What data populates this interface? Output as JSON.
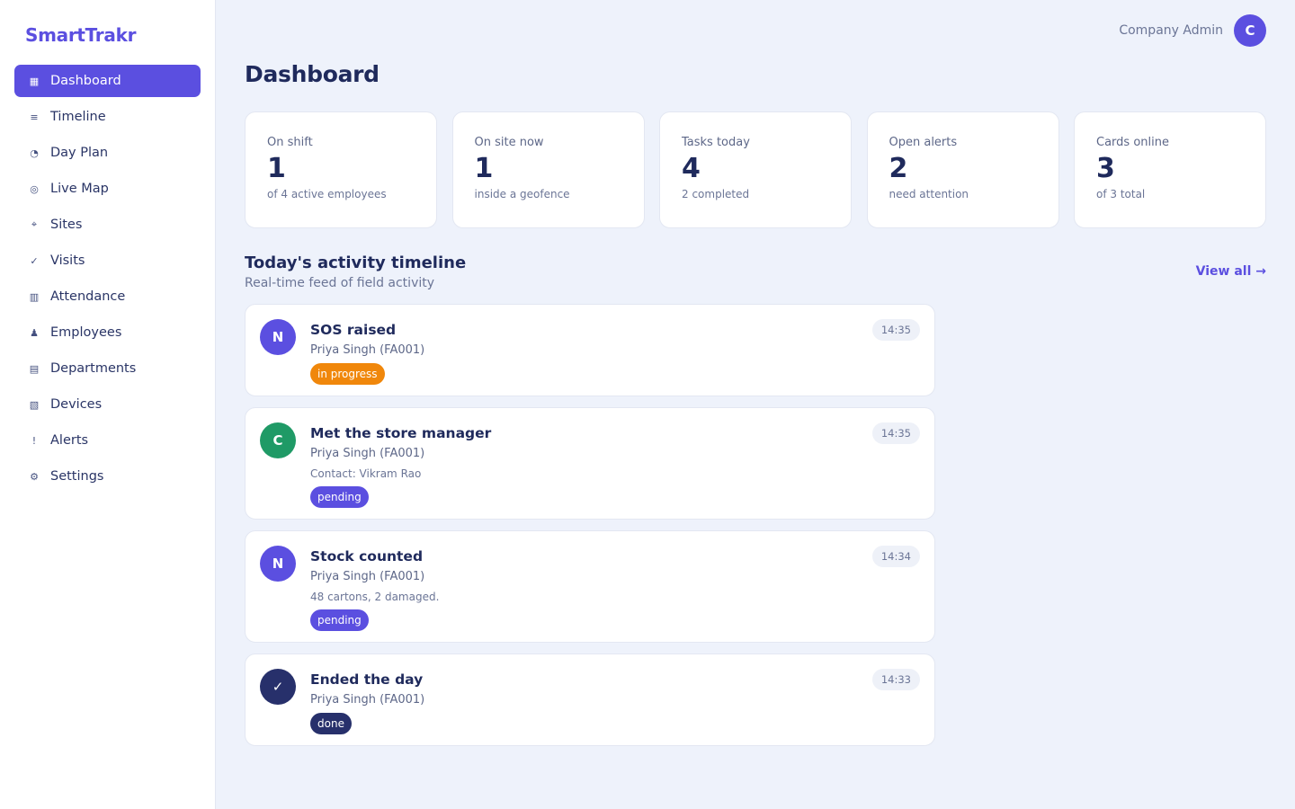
{
  "brand": "SmartTrakr",
  "sidebar": {
    "items": [
      {
        "label": "Dashboard",
        "icon": "grid-icon",
        "glyph": "▦",
        "active": true
      },
      {
        "label": "Timeline",
        "icon": "list-icon",
        "glyph": "≡",
        "active": false
      },
      {
        "label": "Day Plan",
        "icon": "pie-icon",
        "glyph": "◔",
        "active": false
      },
      {
        "label": "Live Map",
        "icon": "target-icon",
        "glyph": "◎",
        "active": false
      },
      {
        "label": "Sites",
        "icon": "crosshair-icon",
        "glyph": "⌖",
        "active": false
      },
      {
        "label": "Visits",
        "icon": "check-icon",
        "glyph": "✓",
        "active": false
      },
      {
        "label": "Attendance",
        "icon": "columns-icon",
        "glyph": "▥",
        "active": false
      },
      {
        "label": "Employees",
        "icon": "person-icon",
        "glyph": "♟",
        "active": false
      },
      {
        "label": "Departments",
        "icon": "rows-icon",
        "glyph": "▤",
        "active": false
      },
      {
        "label": "Devices",
        "icon": "device-icon",
        "glyph": "▧",
        "active": false
      },
      {
        "label": "Alerts",
        "icon": "exclamation-icon",
        "glyph": "!",
        "active": false
      },
      {
        "label": "Settings",
        "icon": "gear-icon",
        "glyph": "⚙",
        "active": false
      }
    ]
  },
  "topbar": {
    "user_name": "Company Admin",
    "avatar_initial": "C"
  },
  "page_title": "Dashboard",
  "stats": [
    {
      "label": "On shift",
      "value": "1",
      "sub": "of 4 active employees"
    },
    {
      "label": "On site now",
      "value": "1",
      "sub": "inside a geofence"
    },
    {
      "label": "Tasks today",
      "value": "4",
      "sub": "2 completed"
    },
    {
      "label": "Open alerts",
      "value": "2",
      "sub": "need attention"
    },
    {
      "label": "Cards online",
      "value": "3",
      "sub": "of 3 total"
    }
  ],
  "timeline": {
    "title": "Today's activity timeline",
    "subtitle": "Real-time feed of field activity",
    "view_all": "View all →",
    "events": [
      {
        "initial": "N",
        "avatar_color": "#5b4fe0",
        "title": "SOS raised",
        "person": "Priya Singh (FA001)",
        "detail": "",
        "status": "in progress",
        "status_class": "in-progress",
        "time": "14:35"
      },
      {
        "initial": "C",
        "avatar_color": "#1f9a66",
        "title": "Met the store manager",
        "person": "Priya Singh (FA001)",
        "detail": "Contact: Vikram Rao",
        "status": "pending",
        "status_class": "pending",
        "time": "14:35"
      },
      {
        "initial": "N",
        "avatar_color": "#5b4fe0",
        "title": "Stock counted",
        "person": "Priya Singh (FA001)",
        "detail": "48 cartons, 2 damaged.",
        "status": "pending",
        "status_class": "pending",
        "time": "14:34"
      },
      {
        "initial": "✓",
        "avatar_color": "#27306b",
        "title": "Ended the day",
        "person": "Priya Singh (FA001)",
        "detail": "",
        "status": "done",
        "status_class": "done",
        "time": "14:33"
      }
    ]
  }
}
